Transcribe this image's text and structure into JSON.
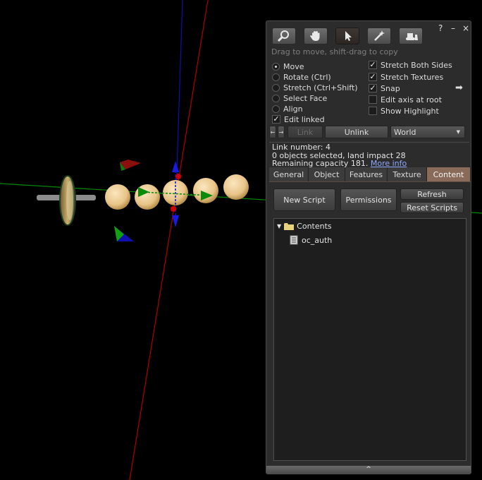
{
  "floater": {
    "help": "?",
    "minimize": "–",
    "close": "×",
    "hint": "Drag to move, shift-drag to copy"
  },
  "tools": [
    {
      "name": "focus",
      "icon": "magnifier-icon"
    },
    {
      "name": "move",
      "icon": "grab-hand-icon"
    },
    {
      "name": "edit",
      "icon": "pointer-icon",
      "active": true
    },
    {
      "name": "create",
      "icon": "magic-wand-icon"
    },
    {
      "name": "land",
      "icon": "bulldozer-icon"
    }
  ],
  "edit_modes": [
    {
      "label": "Move",
      "selected": true
    },
    {
      "label": "Rotate (Ctrl)",
      "selected": false
    },
    {
      "label": "Stretch (Ctrl+Shift)",
      "selected": false
    },
    {
      "label": "Select Face",
      "selected": false
    },
    {
      "label": "Align",
      "selected": false
    }
  ],
  "edit_linked": {
    "label": "Edit linked",
    "checked": true
  },
  "options": [
    {
      "label": "Stretch Both Sides",
      "checked": true
    },
    {
      "label": "Stretch Textures",
      "checked": true
    },
    {
      "label": "Snap",
      "checked": true
    },
    {
      "label": "Edit axis at root",
      "checked": false
    },
    {
      "label": "Show Highlight",
      "checked": false
    }
  ],
  "link_row": {
    "link": "Link",
    "unlink": "Unlink",
    "ruler": "World"
  },
  "info": {
    "link_number": "Link number: 4",
    "selected": "0 objects selected, land impact 28",
    "capacity": "Remaining capacity 181.",
    "more_info": "More info"
  },
  "tabs": [
    {
      "label": "General"
    },
    {
      "label": "Object"
    },
    {
      "label": "Features"
    },
    {
      "label": "Texture"
    },
    {
      "label": "Content",
      "active": true
    }
  ],
  "content": {
    "new_script": "New Script",
    "permissions": "Permissions",
    "refresh": "Refresh",
    "reset_scripts": "Reset Scripts",
    "folder": "Contents",
    "items": [
      {
        "label": "oc_auth",
        "icon": "script-icon"
      }
    ]
  },
  "colors": {
    "active_tab": "#8a6a58",
    "x_axis": "#c00000",
    "y_axis": "#00a000",
    "z_axis": "#0000d0",
    "link_color": "#8fa8ff"
  }
}
